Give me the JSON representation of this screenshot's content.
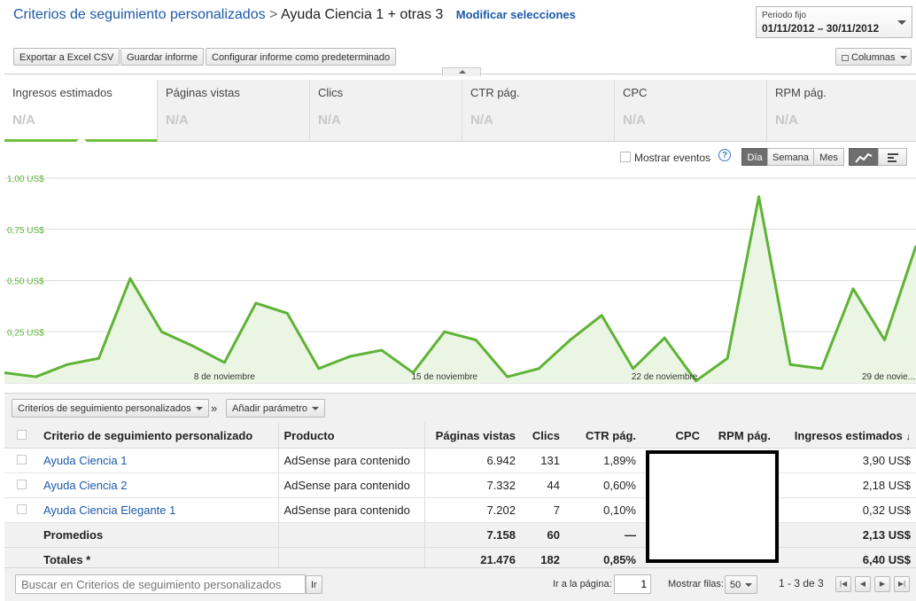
{
  "header": {
    "breadcrumb_link": "Criterios de seguimiento personalizados",
    "separator": ">",
    "current": "Ayuda Ciencia 1 + otras 3",
    "modify_link": "Modificar selecciones"
  },
  "date_range": {
    "label": "Periodo fijo",
    "value": "01/11/2012 – 30/11/2012"
  },
  "toolbar": {
    "export_label": "Exportar a Excel CSV",
    "save_label": "Guardar informe",
    "default_label": "Configurar informe como predeterminado",
    "columns_label": "Columnas"
  },
  "metrics": [
    {
      "name": "Ingresos estimados",
      "value": "N/A"
    },
    {
      "name": "Páginas vistas",
      "value": "N/A"
    },
    {
      "name": "Clics",
      "value": "N/A"
    },
    {
      "name": "CTR pág.",
      "value": "N/A"
    },
    {
      "name": "CPC",
      "value": "N/A"
    },
    {
      "name": "RPM pág.",
      "value": "N/A"
    }
  ],
  "chart_controls": {
    "show_events": "Mostrar eventos",
    "help": "?",
    "day": "Día",
    "week": "Semana",
    "month": "Mes"
  },
  "chart_data": {
    "type": "area",
    "title": "",
    "xlabel": "",
    "ylabel": "",
    "ylim": [
      0,
      1.0
    ],
    "yticks": [
      "1,00 US$",
      "0,75 US$",
      "0,50 US$",
      "0,25 US$"
    ],
    "ytick_values": [
      1.0,
      0.75,
      0.5,
      0.25
    ],
    "xtick_labels": [
      "8 de noviembre",
      "15 de noviembre",
      "22 de noviembre",
      "29 de novie..."
    ],
    "xtick_days": [
      8,
      15,
      22,
      29
    ],
    "x": [
      1,
      2,
      3,
      4,
      5,
      6,
      7,
      8,
      9,
      10,
      11,
      12,
      13,
      14,
      15,
      16,
      17,
      18,
      19,
      20,
      21,
      22,
      23,
      24,
      25,
      26,
      27,
      28,
      29,
      30
    ],
    "values": [
      0.05,
      0.03,
      0.09,
      0.12,
      0.51,
      0.25,
      0.18,
      0.1,
      0.39,
      0.34,
      0.07,
      0.13,
      0.16,
      0.05,
      0.25,
      0.21,
      0.03,
      0.07,
      0.21,
      0.33,
      0.07,
      0.22,
      0.01,
      0.12,
      0.91,
      0.09,
      0.07,
      0.46,
      0.21,
      0.67
    ],
    "color": "#5fb336",
    "grid": true
  },
  "table_toolbar": {
    "dimension": "Criterios de seguimiento personalizados",
    "arrow": "»",
    "add_param": "Añadir parámetro"
  },
  "table": {
    "headers": [
      "Criterio de seguimiento personalizado",
      "Producto",
      "Páginas vistas",
      "Clics",
      "CTR pág.",
      "CPC",
      "RPM pág.",
      "Ingresos estimados"
    ],
    "sort_arrow": "↓",
    "rows": [
      {
        "name": "Ayuda Ciencia 1",
        "product": "AdSense para contenido",
        "pageviews": "6.942",
        "clicks": "131",
        "ctr": "1,89%",
        "cpc": "",
        "rpm": "",
        "revenue": "3,90 US$"
      },
      {
        "name": "Ayuda Ciencia 2",
        "product": "AdSense para contenido",
        "pageviews": "7.332",
        "clicks": "44",
        "ctr": "0,60%",
        "cpc": "",
        "rpm": "",
        "revenue": "2,18 US$"
      },
      {
        "name": "Ayuda Ciencia Elegante 1",
        "product": "AdSense para contenido",
        "pageviews": "7.202",
        "clicks": "7",
        "ctr": "0,10%",
        "cpc": "",
        "rpm": "",
        "revenue": "0,32 US$"
      }
    ],
    "averages": {
      "label": "Promedios",
      "pageviews": "7.158",
      "clicks": "60",
      "ctr": "—",
      "revenue": "2,13 US$"
    },
    "totals": {
      "label": "Totales *",
      "pageviews": "21.476",
      "clicks": "182",
      "ctr": "0,85%",
      "revenue": "6,40 US$"
    }
  },
  "footer": {
    "search_placeholder": "Buscar en Criterios de seguimiento personalizados",
    "go_label": "Ir",
    "goto_label": "Ir a la página:",
    "page_value": "1",
    "rows_label": "Mostrar filas:",
    "rows_value": "50",
    "range": "1 - 3 de 3"
  }
}
